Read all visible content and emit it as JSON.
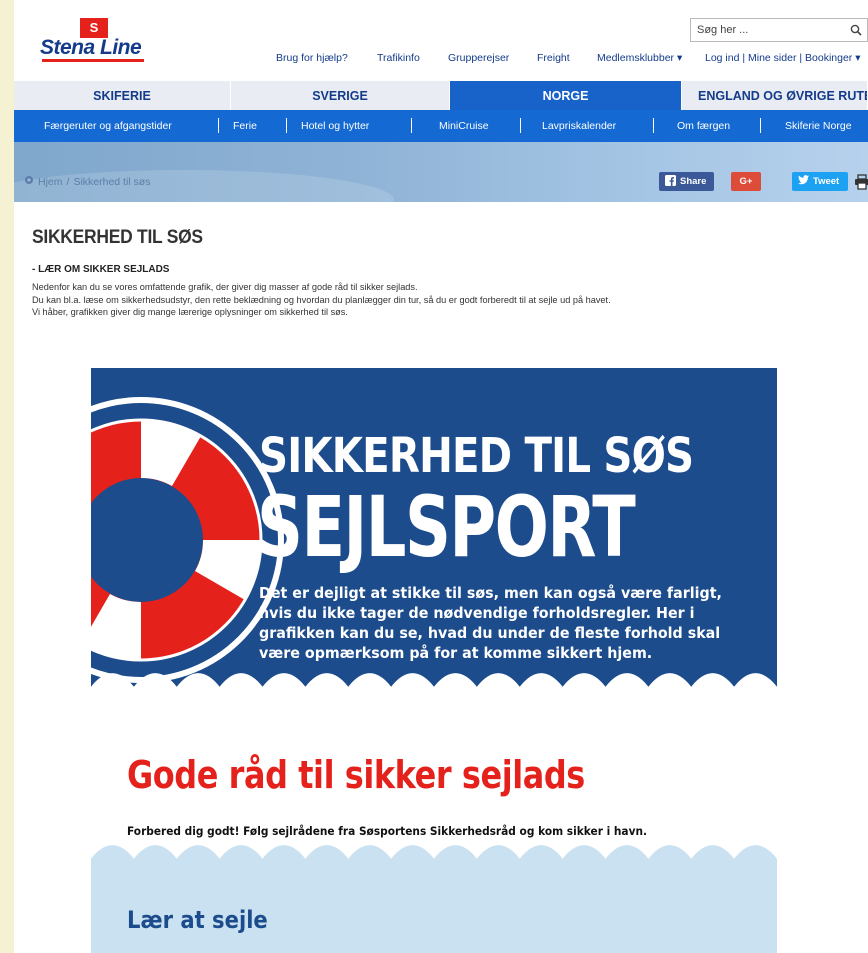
{
  "header": {
    "logo_badge": "S",
    "logo_text": "Stena Line",
    "search": {
      "placeholder": "Søg her ..."
    },
    "top_links": [
      "Brug for hjælp?",
      "Trafikinfo",
      "Grupperejser",
      "Freight",
      "Medlemsklubber ▾",
      "Log ind | Mine sider | Bookinger ▾"
    ]
  },
  "tabs": [
    {
      "label": "SKIFERIE",
      "active": false
    },
    {
      "label": "SVERIGE",
      "active": false
    },
    {
      "label": "NORGE",
      "active": true
    },
    {
      "label": "ENGLAND OG ØVRIGE RUTER",
      "active": false
    }
  ],
  "subnav": [
    "Færgeruter og afgangstider",
    "Ferie",
    "Hotel og hytter",
    "MiniCruise",
    "Lavpriskalender",
    "Om færgen",
    "Skiferie Norge"
  ],
  "breadcrumb": {
    "home": "Hjem",
    "separator": "/",
    "current": "Sikkerhed til søs"
  },
  "share": {
    "facebook": "Share",
    "google": "G+",
    "twitter": "Tweet"
  },
  "article": {
    "title": "SIKKERHED TIL SØS",
    "subtitle": "- LÆR OM SIKKER SEJLADS",
    "intro": [
      "Nedenfor kan du se vores omfattende grafik, der giver dig masser af gode råd til sikker sejlads.",
      "Du kan bl.a. læse om sikkerhedsudstyr, den rette beklædning og hvordan du planlægger din tur, så du er godt forberedt til at sejle ud på havet.",
      "Vi håber, grafikken giver dig mange lærerige oplysninger om sikkerhed til søs."
    ]
  },
  "infographic": {
    "heading1": "SIKKERHED TIL SØS",
    "heading2": "SEJLSPORT",
    "intro_lines": [
      "Det er dejligt at stikke til søs, men kan også være farligt,",
      "hvis du ikke tager de nødvendige forholdsregler. Her i",
      "grafikken kan du se, hvad du under de fleste forhold skal",
      "være opmærksom på for at komme sikkert hjem."
    ],
    "section_title": "Gode råd til sikker sejlads",
    "section_text": "Forbered dig godt! Følg sejlrådene fra Søsportens Sikkerhedsråd og kom sikker i havn.",
    "next_title": "Lær at sejle"
  },
  "colors": {
    "brand_blue": "#143b8b",
    "active_tab": "#1763c9",
    "subnav": "#1469d2",
    "brand_red": "#e5211c",
    "infographic_blue": "#1c4c8c",
    "light_blue": "#c9e1f1"
  }
}
